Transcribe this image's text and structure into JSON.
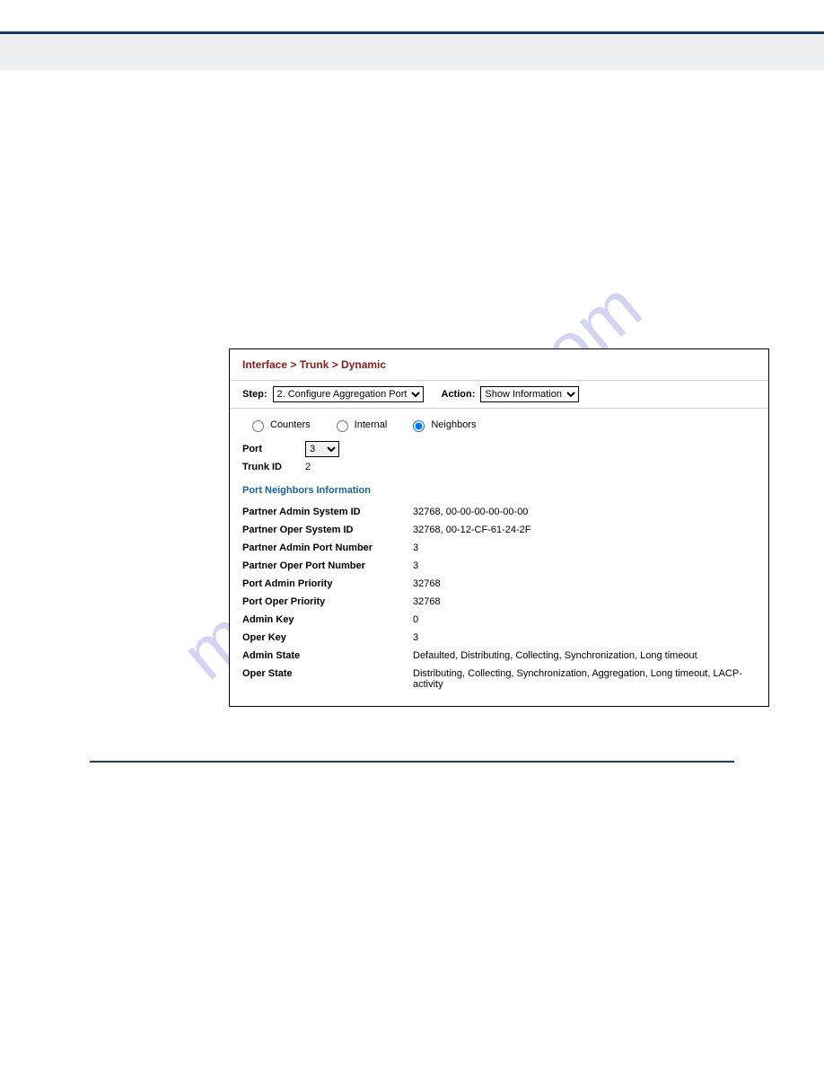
{
  "watermark": "manualshive.com",
  "breadcrumb": "Interface > Trunk > Dynamic",
  "controls": {
    "step_label": "Step:",
    "step_value": "2. Configure Aggregation Port",
    "action_label": "Action:",
    "action_value": "Show Information"
  },
  "radios": {
    "counters": "Counters",
    "internal": "Internal",
    "neighbors": "Neighbors"
  },
  "fields": {
    "port_label": "Port",
    "port_value": "3",
    "trunk_label": "Trunk ID",
    "trunk_value": "2"
  },
  "section_title": "Port Neighbors Information",
  "info": [
    {
      "k": "Partner Admin System ID",
      "v": "32768, 00-00-00-00-00-00"
    },
    {
      "k": "Partner Oper System ID",
      "v": "32768, 00-12-CF-61-24-2F"
    },
    {
      "k": "Partner Admin Port Number",
      "v": "3"
    },
    {
      "k": "Partner Oper Port Number",
      "v": "3"
    },
    {
      "k": "Port Admin Priority",
      "v": "32768"
    },
    {
      "k": "Port Oper Priority",
      "v": "32768"
    },
    {
      "k": "Admin Key",
      "v": "0"
    },
    {
      "k": "Oper Key",
      "v": "3"
    },
    {
      "k": "Admin State",
      "v": "Defaulted, Distributing, Collecting, Synchronization, Long timeout"
    },
    {
      "k": "Oper State",
      "v": "Distributing, Collecting, Synchronization, Aggregation, Long timeout, LACP-activity"
    }
  ]
}
